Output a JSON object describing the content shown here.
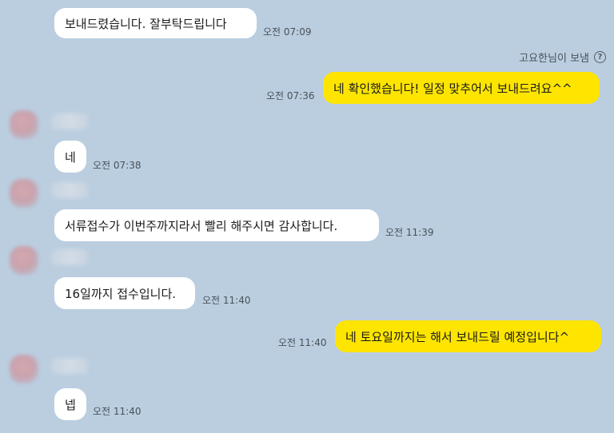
{
  "messages": [
    {
      "text": "보내드렸습니다. 잘부탁드립니다",
      "time": "오전 07:09"
    },
    {
      "text": "네 확인했습니다! 일정 맞추어서 보내드려요^^",
      "time": "오전 07:36"
    },
    {
      "text": "네",
      "time": "오전 07:38"
    },
    {
      "text": "서류접수가 이번주까지라서 빨리 해주시면 감사합니다.",
      "time": "오전 11:39"
    },
    {
      "text": "16일까지 접수입니다.",
      "time": "오전 11:40"
    },
    {
      "text": "네 토요일까지는 해서 보내드릴 예정입니다^",
      "time": "오전 11:40"
    },
    {
      "text": "넵",
      "time": "오전 11:40"
    }
  ],
  "sender_notice": {
    "label": "고요한님이 보냄",
    "icon": "question-circle-icon",
    "glyph": "?"
  },
  "colors": {
    "background": "#bacee0",
    "incoming": "#ffffff",
    "outgoing": "#fee500"
  }
}
